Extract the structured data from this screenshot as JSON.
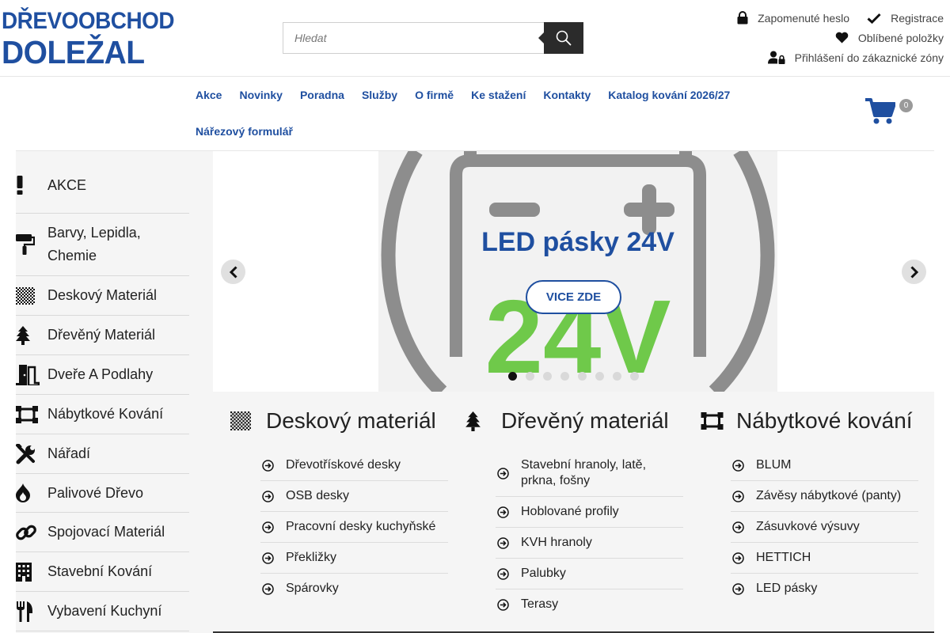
{
  "brand": {
    "line1": "DŘEVOOBCHOD",
    "line2": "DOLEŽAL",
    "color": "#1f4fa0"
  },
  "search": {
    "placeholder": "Hledat",
    "icon": "search-icon"
  },
  "top_links": {
    "forgot_password": "Zapomenuté heslo",
    "register": "Registrace",
    "favorites": "Oblíbené položky",
    "login": "Přihlášení do zákaznické zóny"
  },
  "nav": {
    "row1": [
      "Akce",
      "Novinky",
      "Poradna",
      "Služby",
      "O firmě",
      "Ke stažení",
      "Kontakty",
      "Katalog kování 2026/27"
    ],
    "row2": [
      "Nářezový formulář"
    ]
  },
  "cart": {
    "count": "0",
    "icon": "cart-icon"
  },
  "sidebar": {
    "items": [
      {
        "label": "AKCE",
        "icon": "exclamation-icon"
      },
      {
        "label": "Barvy, Lepidla, Chemie",
        "icon": "paint-roller-icon"
      },
      {
        "label": "Deskový Materiál",
        "icon": "checkerboard-icon"
      },
      {
        "label": "Dřevěný Materiál",
        "icon": "tree-icon"
      },
      {
        "label": "Dveře A Podlahy",
        "icon": "door-icon"
      },
      {
        "label": "Nábytkové Kování",
        "icon": "hardware-icon"
      },
      {
        "label": "Nářadí",
        "icon": "tools-icon"
      },
      {
        "label": "Palivové Dřevo",
        "icon": "fire-icon"
      },
      {
        "label": "Spojovací Materiál",
        "icon": "link-icon"
      },
      {
        "label": "Stavební Kování",
        "icon": "building-icon"
      },
      {
        "label": "Vybavení Kuchyní",
        "icon": "utensils-icon"
      }
    ]
  },
  "slider": {
    "title": "LED pásky 24V",
    "cta": "VICE ZDE",
    "art_text": "24V",
    "slide_count": 8,
    "active_slide": 1,
    "accent_green": "#6fc94a"
  },
  "categories": [
    {
      "title": "Deskový materiál",
      "icon": "checkerboard-icon",
      "items": [
        "Dřevotřískové desky",
        "OSB desky",
        "Pracovní desky kuchyňské",
        "Překližky",
        "Spárovky"
      ]
    },
    {
      "title": "Dřevěný materiál",
      "icon": "tree-icon",
      "items": [
        "Stavební hranoly, latě, prkna, fošny",
        "Hoblované profily",
        "KVH hranoly",
        "Palubky",
        "Terasy"
      ]
    },
    {
      "title": "Nábytkové kování",
      "icon": "hardware-icon",
      "items": [
        "BLUM",
        "Závěsy nábytkové (panty)",
        "Zásuvkové výsuvy",
        "HETTICH",
        "LED pásky"
      ]
    }
  ]
}
